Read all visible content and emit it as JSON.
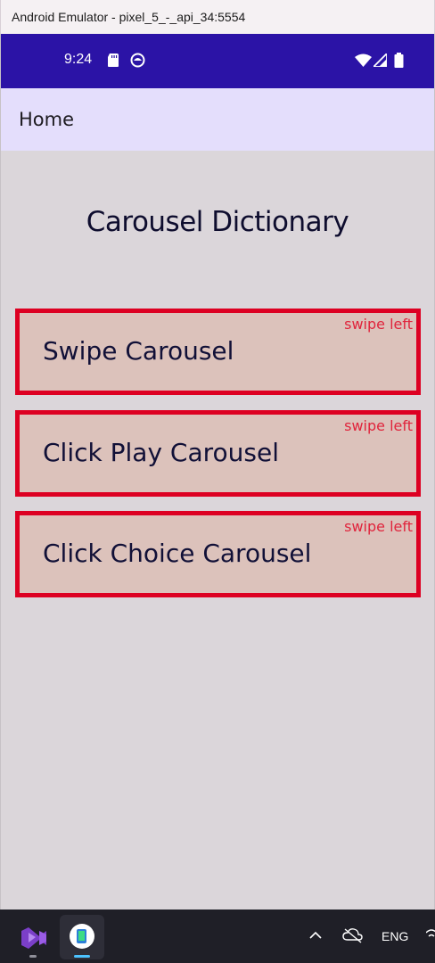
{
  "window": {
    "title": "Android Emulator - pixel_5_-_api_34:5554"
  },
  "status_bar": {
    "time": "9:24",
    "left_icons": [
      "sd-card-icon",
      "app-notification-icon"
    ],
    "right_icons": [
      "wifi-icon",
      "signal-icon",
      "battery-icon"
    ],
    "color": "#2b13a6"
  },
  "app_bar": {
    "title": "Home",
    "color": "#e4defc"
  },
  "page": {
    "title": "Carousel Dictionary"
  },
  "cards": [
    {
      "label": "Swipe Carousel",
      "hint": "swipe left"
    },
    {
      "label": "Click Play Carousel",
      "hint": "swipe left"
    },
    {
      "label": "Click Choice Carousel",
      "hint": "swipe left"
    }
  ],
  "card_style": {
    "border_color": "#dd0022",
    "background": "#dcc2bb",
    "hint_color": "#e0243c"
  },
  "taskbar": {
    "apps": [
      "visual-studio-icon",
      "android-emulator-icon"
    ],
    "tray_icons": [
      "chevron-up-icon",
      "cloud-offline-icon"
    ],
    "language": "ENG"
  }
}
